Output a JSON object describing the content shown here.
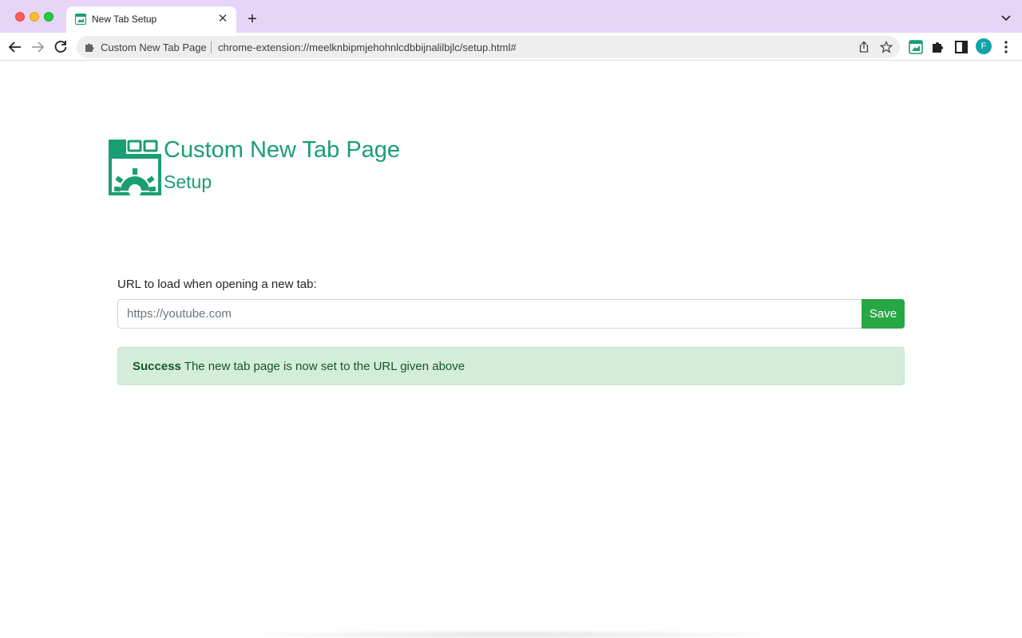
{
  "browser": {
    "tab": {
      "title": "New Tab Setup",
      "favicon": "calendar-grid-icon",
      "close_icon": "close-icon"
    },
    "new_tab_icon": "plus-icon",
    "tab_search_icon": "chevron-down-icon",
    "nav": {
      "back_icon": "arrow-left-icon",
      "forward_icon": "arrow-right-icon",
      "reload_icon": "reload-icon"
    },
    "omnibox": {
      "extension_label": "Custom New Tab Page",
      "url": "chrome-extension://meelknbipmjehohnlcdbbijnalilbjlc/setup.html#"
    },
    "profile_initial": "F",
    "colors": {
      "tabstrip": "#e6d5f7",
      "avatar": "#12a4a8"
    }
  },
  "page": {
    "title": "Custom New Tab Page",
    "subtitle": "Setup",
    "brand_color": "#1a9e74",
    "form": {
      "label": "URL to load when opening a new tab:",
      "placeholder": "https://youtube.com",
      "value": "",
      "save_label": "Save",
      "save_color": "#28a745"
    },
    "alert": {
      "strong": "Success",
      "message": " The new tab page is now set to the URL given above",
      "bg_color": "#d4edda"
    }
  }
}
